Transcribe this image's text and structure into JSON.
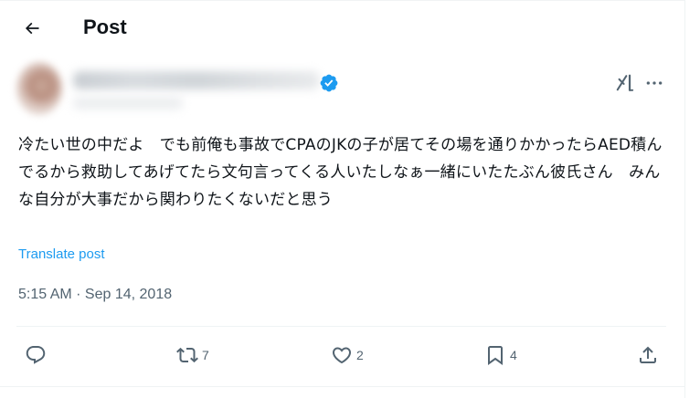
{
  "header": {
    "title": "Post",
    "back_icon": "arrow-left-icon"
  },
  "tweet": {
    "author_verified_icon": "verified-badge-icon",
    "text": "冷たい世の中だよ　でも前俺も事故でCPAのJKの子が居てその場を通りかかったらAED積んでるから救助してあげてたら文句言ってくる人いたしなぁ一緒にいたたぶん彼氏さん　みんな自分が大事だから関わりたくないだと思う",
    "translate_label": "Translate post",
    "timestamp": "5:15 AM · Sep 14, 2018"
  },
  "actions": {
    "reply": {
      "icon": "reply-icon",
      "count": ""
    },
    "repost": {
      "icon": "repost-icon",
      "count": "7"
    },
    "like": {
      "icon": "heart-icon",
      "count": "2"
    },
    "bookmark": {
      "icon": "bookmark-icon",
      "count": "4"
    },
    "share": {
      "icon": "share-icon",
      "count": ""
    }
  },
  "colors": {
    "text": "#0f1419",
    "secondary": "#536471",
    "link": "#1d9bf0",
    "verified": "#1d9bf0",
    "divider": "#eff3f4"
  }
}
